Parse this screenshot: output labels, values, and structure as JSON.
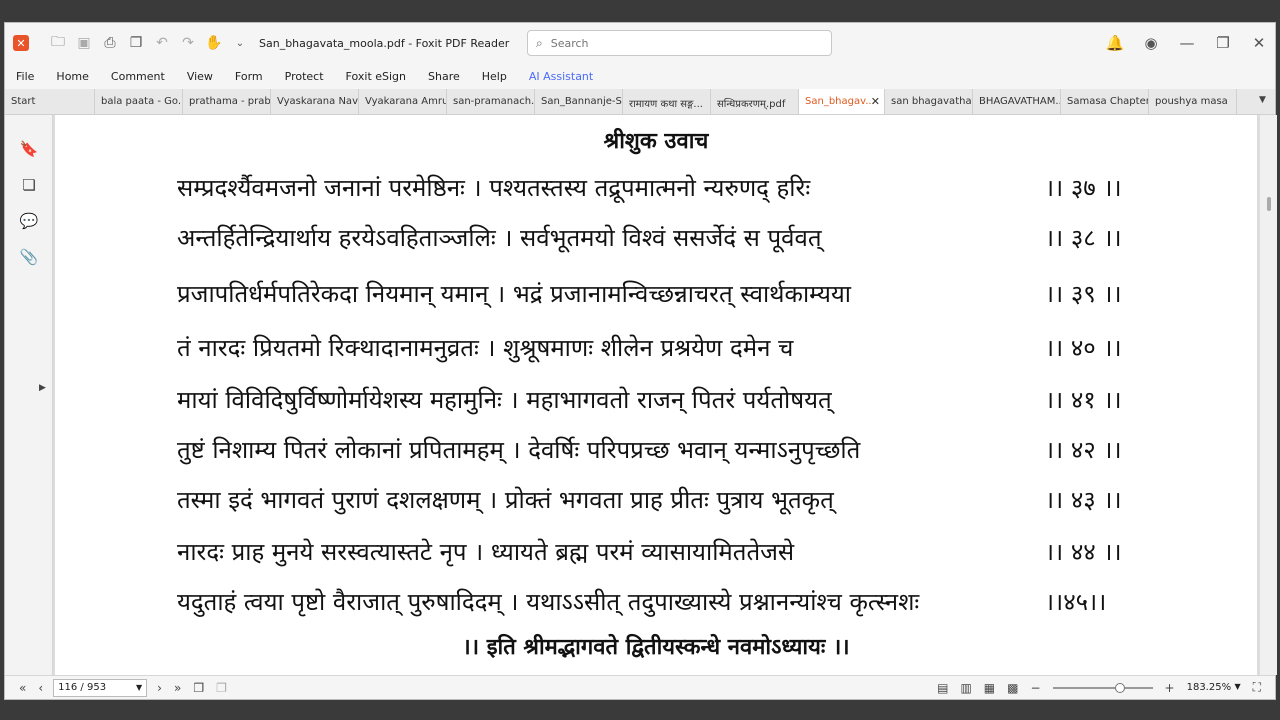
{
  "window": {
    "title": "San_bhagavata_moola.pdf - Foxit PDF Reader",
    "search_placeholder": "Search"
  },
  "menu": [
    "File",
    "Home",
    "Comment",
    "View",
    "Form",
    "Protect",
    "Foxit eSign",
    "Share",
    "Help",
    "AI Assistant"
  ],
  "tabs": [
    {
      "label": "Start"
    },
    {
      "label": "bala paata - Go..."
    },
    {
      "label": "prathama - prab..."
    },
    {
      "label": "Vyaskarana Nav..."
    },
    {
      "label": "Vyakarana Amru..."
    },
    {
      "label": "san-pramanach..."
    },
    {
      "label": "San_Bannanje-S..."
    },
    {
      "label": "रामायण कथा सङ्ग..."
    },
    {
      "label": "सन्धिप्रकरणम्.pdf"
    },
    {
      "label": "San_bhagav..."
    },
    {
      "label": "san bhagavathat..."
    },
    {
      "label": "BHAGAVATHAM..."
    },
    {
      "label": "Samasa Chapter..."
    },
    {
      "label": "poushya masa"
    }
  ],
  "active_tab": 9,
  "document": {
    "heading": "श्रीशुक उवाच",
    "verses": [
      {
        "text": "सम्प्रदर्श्यैवमजनो जनानां परमेष्ठिनः । पश्यतस्तस्य तद्रूपमात्मनो न्यरुणद् हरिः",
        "num": "।। ३७ ।।"
      },
      {
        "text": "अन्तर्हितेन्द्रियार्थाय हरयेऽवहिताञ्जलिः । सर्वभूतमयो विश्वं ससर्जेदं स पूर्ववत्",
        "num": "।। ३८ ।।"
      },
      {
        "text": "प्रजापतिर्धर्मपतिरेकदा नियमान् यमान् । भद्रं प्रजानामन्विच्छन्नाचरत् स्वार्थकाम्यया",
        "num": "।। ३९ ।।"
      },
      {
        "text": "तं नारदः प्रियतमो रिक्थादानामनुव्रतः । शुश्रूषमाणः शीलेन प्रश्रयेण दमेन च",
        "num": "।। ४० ।।"
      },
      {
        "text": "मायां विविदिषुर्विष्णोर्मायेशस्य महामुनिः । महाभागवतो राजन् पितरं पर्यतोषयत्",
        "num": "।। ४१ ।।"
      },
      {
        "text": "तुष्टं निशाम्य पितरं लोकानां प्रपितामहम् । देवर्षिः परिपप्रच्छ भवान् यन्माऽनुपृच्छति",
        "num": "।। ४२ ।।"
      },
      {
        "text": "तस्मा इदं भागवतं पुराणं दशलक्षणम् । प्रोक्तं भगवता प्राह प्रीतः पुत्राय भूतकृत्",
        "num": "।। ४३ ।।"
      },
      {
        "text": "नारदः प्राह मुनये सरस्वत्यास्तटे नृप । ध्यायते ब्रह्म परमं व्यासायामिततेजसे",
        "num": "।। ४४ ।।"
      },
      {
        "text": "यदुताहं त्वया पृष्टो वैराजात् पुरुषादिदम् । यथाऽऽसीत् तदुपाख्यास्ये प्रश्नानन्यांश्च कृत्स्नशः",
        "num": "।।४५।।"
      }
    ],
    "footer": "।। इति श्रीमद्भागवते द्वितीयस्कन्धे नवमोऽध्यायः ।।"
  },
  "status": {
    "page": "116 / 953",
    "zoom": "183.25%"
  }
}
